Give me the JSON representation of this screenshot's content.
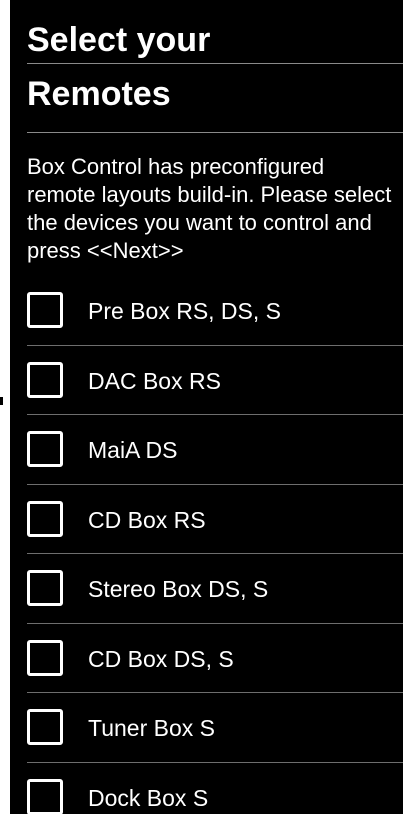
{
  "header": {
    "title_line1": "Select your",
    "title_line2": "Remotes"
  },
  "description": "Box Control has preconfigured remote layouts build-in. Please select the devices you want to control and press <<Next>>",
  "devices": [
    {
      "label": "Pre Box RS, DS, S",
      "checked": false
    },
    {
      "label": "DAC Box RS",
      "checked": false
    },
    {
      "label": "MaiA DS",
      "checked": false
    },
    {
      "label": "CD Box RS",
      "checked": false
    },
    {
      "label": "Stereo Box DS, S",
      "checked": false
    },
    {
      "label": "CD Box DS, S",
      "checked": false
    },
    {
      "label": "Tuner Box S",
      "checked": false
    },
    {
      "label": "Dock Box S",
      "checked": false
    }
  ],
  "colors": {
    "background": "#000000",
    "text": "#ffffff",
    "divider": "#6e6e6e"
  }
}
